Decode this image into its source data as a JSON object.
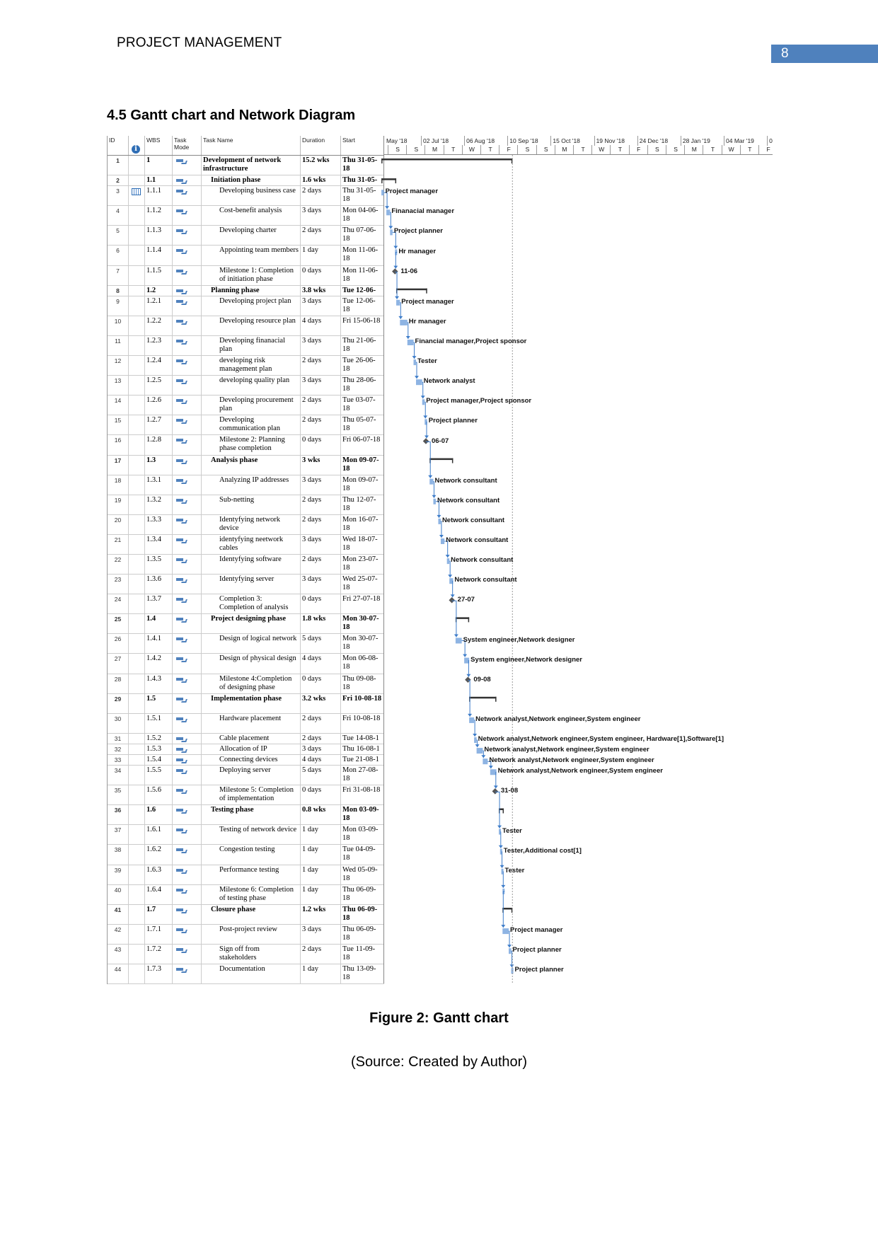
{
  "header": {
    "running_title": "PROJECT MANAGEMENT",
    "page_number": "8"
  },
  "section_title": "4.5 Gantt chart and Network Diagram",
  "colors": {
    "page_number_bg": "#4f81bd",
    "task_bar": "#8eb4e3",
    "connector": "#3d7cc9",
    "milestone": "#555555",
    "summary_bar": "#333333"
  },
  "table": {
    "columns": {
      "id": "ID",
      "info": "info-icon",
      "wbs": "WBS",
      "mode": "Task Mode",
      "name": "Task Name",
      "duration": "Duration",
      "start": "Start"
    }
  },
  "timescale": {
    "top_tier": [
      "May '18",
      "02 Jul '18",
      "06 Aug '18",
      "10 Sep '18",
      "15 Oct '18",
      "19 Nov '18",
      "24 Dec '18",
      "28 Jan '19",
      "04 Mar '19",
      "0"
    ],
    "bottom_tier": [
      "S",
      "S",
      "M",
      "T",
      "W",
      "T",
      "F",
      "S",
      "S",
      "M",
      "T",
      "W",
      "T",
      "F",
      "S",
      "S",
      "M",
      "T",
      "W",
      "T",
      "F"
    ]
  },
  "chart_data": {
    "type": "gantt",
    "tasks": [
      {
        "id": "1",
        "wbs": "1",
        "name": "Development of network infrastructure",
        "duration": "15.2 wks",
        "start": "Thu 31-05-18",
        "level": 0,
        "summary": true
      },
      {
        "id": "2",
        "wbs": "1.1",
        "name": "Initiation phase",
        "duration": "1.6 wks",
        "start": "Thu 31-05-",
        "level": 1,
        "summary": true
      },
      {
        "id": "3",
        "wbs": "1.1.1",
        "name": "Developing business case",
        "duration": "2 days",
        "start": "Thu 31-05-18",
        "level": 2,
        "resource": "Project manager",
        "indicator": "calendar-icon"
      },
      {
        "id": "4",
        "wbs": "1.1.2",
        "name": "Cost-benefit analysis",
        "duration": "3 days",
        "start": "Mon 04-06-18",
        "level": 2,
        "resource": "Finanacial manager"
      },
      {
        "id": "5",
        "wbs": "1.1.3",
        "name": "Developing charter",
        "duration": "2 days",
        "start": "Thu 07-06-18",
        "level": 2,
        "resource": "Project planner"
      },
      {
        "id": "6",
        "wbs": "1.1.4",
        "name": "Appointing team members",
        "duration": "1 day",
        "start": "Mon 11-06-18",
        "level": 2,
        "resource": "Hr manager"
      },
      {
        "id": "7",
        "wbs": "1.1.5",
        "name": "Milestone 1: Completion of initiation phase",
        "duration": "0 days",
        "start": "Mon 11-06-18",
        "level": 2,
        "milestone": true,
        "resource": "11-06"
      },
      {
        "id": "8",
        "wbs": "1.2",
        "name": "Planning phase",
        "duration": "3.8 wks",
        "start": "Tue 12-06-",
        "level": 1,
        "summary": true
      },
      {
        "id": "9",
        "wbs": "1.2.1",
        "name": "Developing project plan",
        "duration": "3 days",
        "start": "Tue 12-06-18",
        "level": 2,
        "resource": "Project manager"
      },
      {
        "id": "10",
        "wbs": "1.2.2",
        "name": "Developing resource plan",
        "duration": "4 days",
        "start": "Fri 15-06-18",
        "level": 2,
        "resource": "Hr manager"
      },
      {
        "id": "11",
        "wbs": "1.2.3",
        "name": "Developing finanacial plan",
        "duration": "3 days",
        "start": "Thu 21-06-18",
        "level": 2,
        "resource": "Financial manager,Project sponsor"
      },
      {
        "id": "12",
        "wbs": "1.2.4",
        "name": "developing risk management plan",
        "duration": "2 days",
        "start": "Tue 26-06-18",
        "level": 2,
        "resource": "Tester"
      },
      {
        "id": "13",
        "wbs": "1.2.5",
        "name": "developing quality plan",
        "duration": "3 days",
        "start": "Thu 28-06-18",
        "level": 2,
        "resource": "Network analyst"
      },
      {
        "id": "14",
        "wbs": "1.2.6",
        "name": "Developing procurement plan",
        "duration": "2 days",
        "start": "Tue 03-07-18",
        "level": 2,
        "resource": "Project manager,Project sponsor"
      },
      {
        "id": "15",
        "wbs": "1.2.7",
        "name": "Developing communication plan",
        "duration": "2 days",
        "start": "Thu 05-07-18",
        "level": 2,
        "resource": "Project planner"
      },
      {
        "id": "16",
        "wbs": "1.2.8",
        "name": "Milestone 2: Planning phase completion",
        "duration": "0 days",
        "start": "Fri 06-07-18",
        "level": 2,
        "milestone": true,
        "resource": "06-07"
      },
      {
        "id": "17",
        "wbs": "1.3",
        "name": "Analysis phase",
        "duration": "3 wks",
        "start": "Mon 09-07-18",
        "level": 1,
        "summary": true
      },
      {
        "id": "18",
        "wbs": "1.3.1",
        "name": "Analyzing IP addresses",
        "duration": "3 days",
        "start": "Mon 09-07-18",
        "level": 2,
        "resource": "Network consultant"
      },
      {
        "id": "19",
        "wbs": "1.3.2",
        "name": "Sub-netting",
        "duration": "2 days",
        "start": "Thu 12-07-18",
        "level": 2,
        "resource": "Network consultant"
      },
      {
        "id": "20",
        "wbs": "1.3.3",
        "name": "Identyfying network device",
        "duration": "2 days",
        "start": "Mon 16-07-18",
        "level": 2,
        "resource": "Network consultant"
      },
      {
        "id": "21",
        "wbs": "1.3.4",
        "name": "identyfying neetwork cables",
        "duration": "3 days",
        "start": "Wed 18-07-18",
        "level": 2,
        "resource": "Network consultant"
      },
      {
        "id": "22",
        "wbs": "1.3.5",
        "name": "Identyfying software",
        "duration": "2 days",
        "start": "Mon 23-07-18",
        "level": 2,
        "resource": "Network consultant"
      },
      {
        "id": "23",
        "wbs": "1.3.6",
        "name": "Identyfying server",
        "duration": "3 days",
        "start": "Wed 25-07-18",
        "level": 2,
        "resource": "Network consultant"
      },
      {
        "id": "24",
        "wbs": "1.3.7",
        "name": "Completion 3: Completion of analysis",
        "duration": "0 days",
        "start": "Fri 27-07-18",
        "level": 2,
        "milestone": true,
        "resource": "27-07"
      },
      {
        "id": "25",
        "wbs": "1.4",
        "name": "Project designing phase",
        "duration": "1.8 wks",
        "start": "Mon 30-07-18",
        "level": 1,
        "summary": true
      },
      {
        "id": "26",
        "wbs": "1.4.1",
        "name": "Design of logical network",
        "duration": "5 days",
        "start": "Mon 30-07-18",
        "level": 2,
        "resource": "System engineer,Network designer"
      },
      {
        "id": "27",
        "wbs": "1.4.2",
        "name": "Design of physical design",
        "duration": "4 days",
        "start": "Mon 06-08-18",
        "level": 2,
        "resource": "System engineer,Network designer"
      },
      {
        "id": "28",
        "wbs": "1.4.3",
        "name": "Milestone 4:Completion of designing phase",
        "duration": "0 days",
        "start": "Thu 09-08-18",
        "level": 2,
        "milestone": true,
        "resource": "09-08"
      },
      {
        "id": "29",
        "wbs": "1.5",
        "name": "Implementation phase",
        "duration": "3.2 wks",
        "start": "Fri 10-08-18",
        "level": 1,
        "summary": true
      },
      {
        "id": "30",
        "wbs": "1.5.1",
        "name": "Hardware placement",
        "duration": "2 days",
        "start": "Fri 10-08-18",
        "level": 2,
        "resource": "Network analyst,Network engineer,System engineer"
      },
      {
        "id": "31",
        "wbs": "1.5.2",
        "name": "Cable placement",
        "duration": "2 days",
        "start": "Tue 14-08-1",
        "level": 2,
        "resource": "Network analyst,Network engineer,System engineer, Hardware[1],Software[1]"
      },
      {
        "id": "32",
        "wbs": "1.5.3",
        "name": "Allocation of IP",
        "duration": "3 days",
        "start": "Thu 16-08-1",
        "level": 2,
        "resource": "Network analyst,Network engineer,System engineer"
      },
      {
        "id": "33",
        "wbs": "1.5.4",
        "name": "Connecting devices",
        "duration": "4 days",
        "start": "Tue 21-08-1",
        "level": 2,
        "resource": "Network analyst,Network engineer,System engineer"
      },
      {
        "id": "34",
        "wbs": "1.5.5",
        "name": "Deploying server",
        "duration": "5 days",
        "start": "Mon 27-08-18",
        "level": 2,
        "resource": "Network analyst,Network engineer,System engineer"
      },
      {
        "id": "35",
        "wbs": "1.5.6",
        "name": "Milestone 5: Completion of implementation",
        "duration": "0 days",
        "start": "Fri 31-08-18",
        "level": 2,
        "milestone": true,
        "resource": "31-08"
      },
      {
        "id": "36",
        "wbs": "1.6",
        "name": "Testing phase",
        "duration": "0.8 wks",
        "start": "Mon 03-09-18",
        "level": 1,
        "summary": true
      },
      {
        "id": "37",
        "wbs": "1.6.1",
        "name": "Testing of network device",
        "duration": "1 day",
        "start": "Mon 03-09-18",
        "level": 2,
        "resource": "Tester"
      },
      {
        "id": "38",
        "wbs": "1.6.2",
        "name": "Congestion testing",
        "duration": "1 day",
        "start": "Tue 04-09-18",
        "level": 2,
        "resource": "Tester,Additional cost[1]"
      },
      {
        "id": "39",
        "wbs": "1.6.3",
        "name": "Performance testing",
        "duration": "1 day",
        "start": "Wed 05-09-18",
        "level": 2,
        "resource": "Tester"
      },
      {
        "id": "40",
        "wbs": "1.6.4",
        "name": "Milestone 6: Completion of testing phase",
        "duration": "1 day",
        "start": "Thu 06-09-18",
        "level": 2
      },
      {
        "id": "41",
        "wbs": "1.7",
        "name": "Closure phase",
        "duration": "1.2 wks",
        "start": "Thu 06-09-18",
        "level": 1,
        "summary": true
      },
      {
        "id": "42",
        "wbs": "1.7.1",
        "name": "Post-project review",
        "duration": "3 days",
        "start": "Thu 06-09-18",
        "level": 2,
        "resource": "Project manager"
      },
      {
        "id": "43",
        "wbs": "1.7.2",
        "name": "Sign off from stakeholders",
        "duration": "2 days",
        "start": "Tue 11-09-18",
        "level": 2,
        "resource": "Project planner"
      },
      {
        "id": "44",
        "wbs": "1.7.3",
        "name": "Documentation",
        "duration": "1 day",
        "start": "Thu 13-09-18",
        "level": 2,
        "resource": "Project planner"
      }
    ]
  },
  "figure": {
    "caption": "Figure 2: Gantt chart",
    "source": "(Source: Created by Author)"
  }
}
